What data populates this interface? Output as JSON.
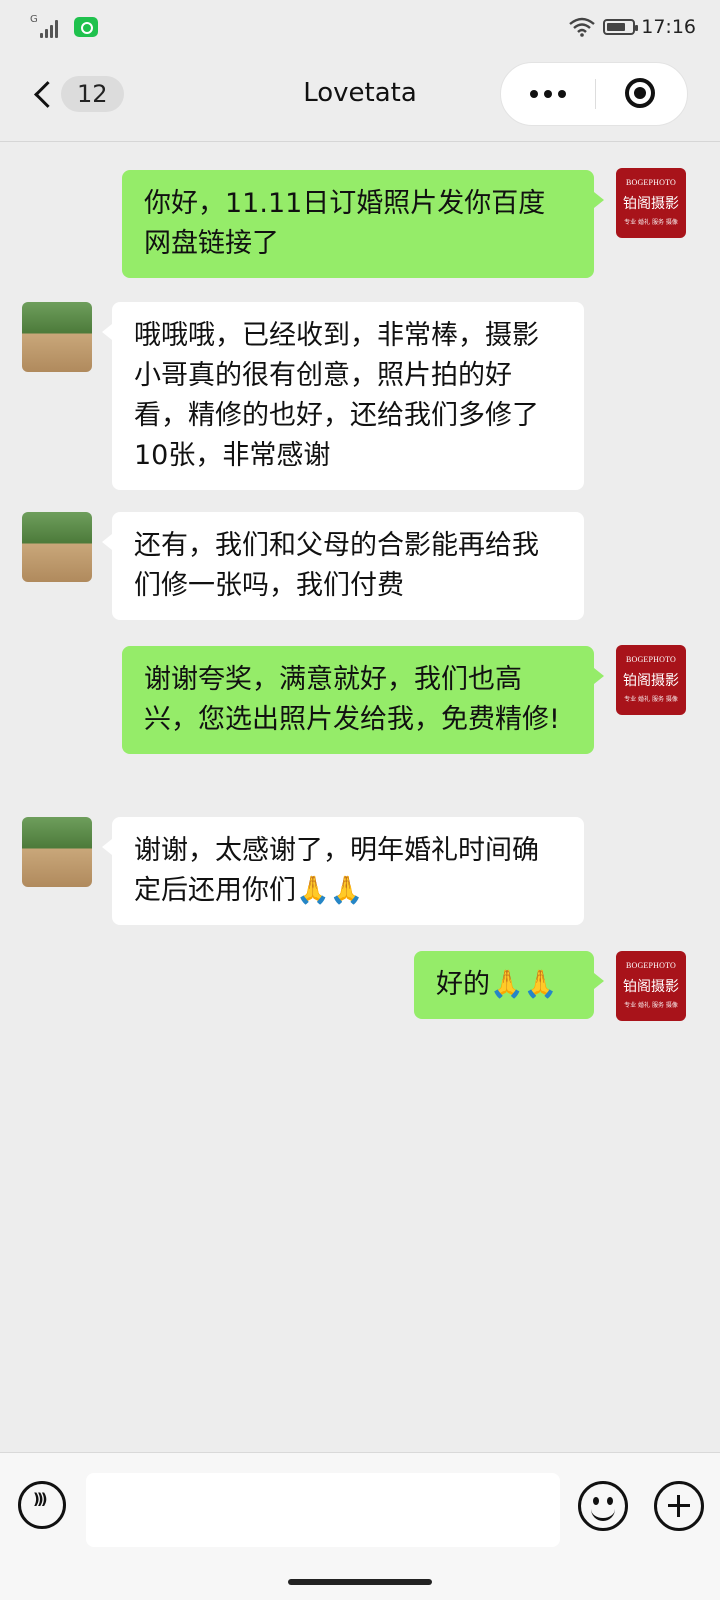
{
  "status_bar": {
    "time": "17:16",
    "signal_label": "G",
    "battery_level": 0.75
  },
  "header": {
    "back_count": "12",
    "title": "Lovetata",
    "more_icon": "more-dots-icon",
    "target_icon": "target-icon"
  },
  "brand_avatar": {
    "line1": "BOGEPHOTO",
    "line2": "铂阁摄影",
    "line3": "专业 婚礼 服务 摄像"
  },
  "messages": [
    {
      "side": "me",
      "text": "你好，11.11日订婚照片发你百度网盘链接了"
    },
    {
      "side": "them",
      "text": "哦哦哦，已经收到，非常棒，摄影小哥真的很有创意，照片拍的好看，精修的也好，还给我们多修了10张，非常感谢"
    },
    {
      "side": "them",
      "text": "还有，我们和父母的合影能再给我们修一张吗，我们付费"
    },
    {
      "side": "me",
      "text": "谢谢夸奖，满意就好，我们也高兴，您选出照片发给我，免费精修!"
    },
    {
      "side": "them",
      "text": "谢谢，太感谢了，明年婚礼时间确定后还用你们🙏🙏"
    },
    {
      "side": "me",
      "text": "好的🙏🙏"
    }
  ],
  "input_bar": {
    "voice_icon": "voice-icon",
    "emoji_icon": "emoji-icon",
    "plus_icon": "plus-icon",
    "placeholder": ""
  }
}
